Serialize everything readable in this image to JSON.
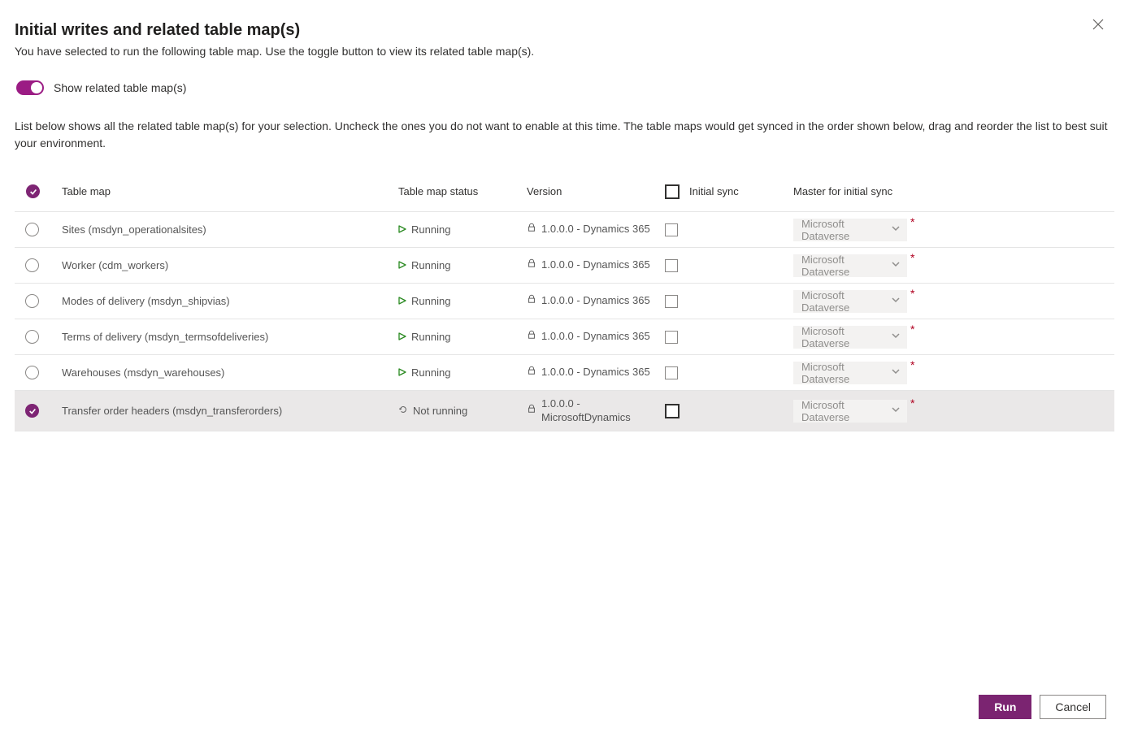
{
  "header": {
    "title": "Initial writes and related table map(s)",
    "subtitle": "You have selected to run the following table map. Use the toggle button to view its related table map(s)."
  },
  "toggle": {
    "label": "Show related table map(s)"
  },
  "description": "List below shows all the related table map(s) for your selection. Uncheck the ones you do not want to enable at this time. The table maps would get synced in the order shown below, drag and reorder the list to best suit your environment.",
  "columns": {
    "tableMap": "Table map",
    "status": "Table map status",
    "version": "Version",
    "initialSync": "Initial sync",
    "master": "Master for initial sync"
  },
  "status": {
    "running": "Running",
    "notRunning": "Not running"
  },
  "rows": [
    {
      "name": "Sites (msdyn_operationalsites)",
      "statusKey": "running",
      "version": "1.0.0.0 - Dynamics 365",
      "master": "Microsoft Dataverse",
      "selected": false
    },
    {
      "name": "Worker (cdm_workers)",
      "statusKey": "running",
      "version": "1.0.0.0 - Dynamics 365",
      "master": "Microsoft Dataverse",
      "selected": false
    },
    {
      "name": "Modes of delivery (msdyn_shipvias)",
      "statusKey": "running",
      "version": "1.0.0.0 - Dynamics 365",
      "master": "Microsoft Dataverse",
      "selected": false
    },
    {
      "name": "Terms of delivery (msdyn_termsofdeliveries)",
      "statusKey": "running",
      "version": "1.0.0.0 - Dynamics 365",
      "master": "Microsoft Dataverse",
      "selected": false
    },
    {
      "name": "Warehouses (msdyn_warehouses)",
      "statusKey": "running",
      "version": "1.0.0.0 - Dynamics 365",
      "master": "Microsoft Dataverse",
      "selected": false
    },
    {
      "name": "Transfer order headers (msdyn_transferorders)",
      "statusKey": "notRunning",
      "version": "1.0.0.0 - MicrosoftDynamics",
      "master": "Microsoft Dataverse",
      "selected": true
    }
  ],
  "buttons": {
    "run": "Run",
    "cancel": "Cancel"
  }
}
